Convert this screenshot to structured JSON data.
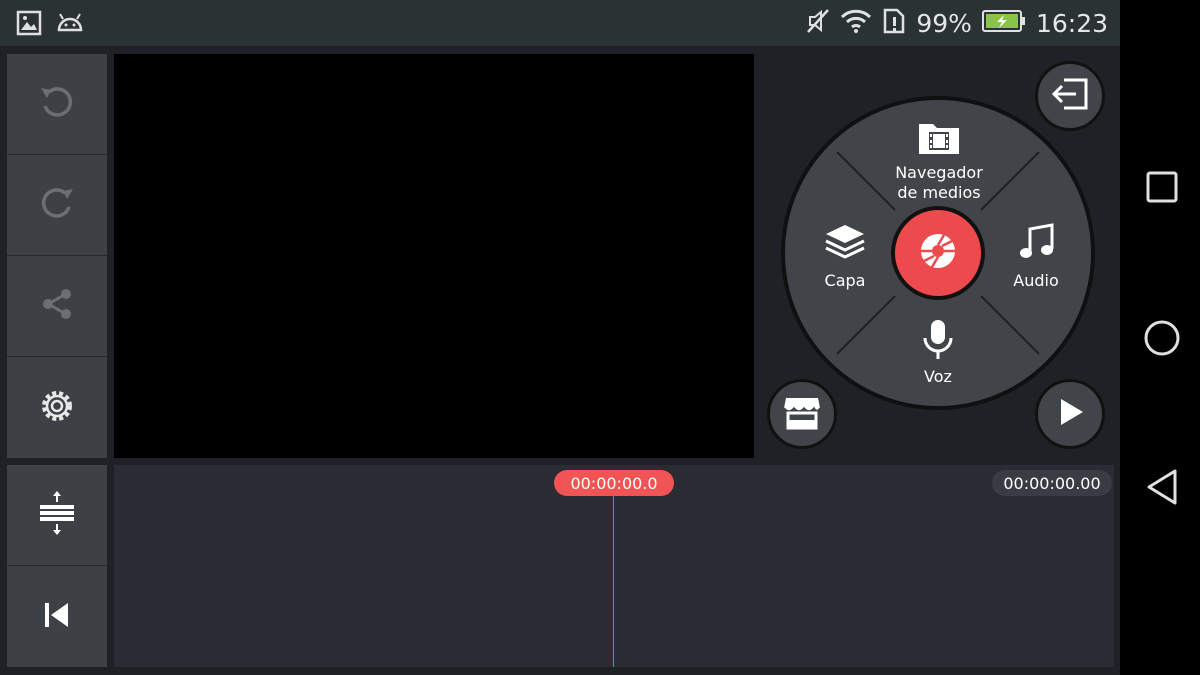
{
  "status_bar": {
    "battery_percent": "99%",
    "time": "16:23",
    "icons": [
      "gallery-icon",
      "android-icon",
      "mute-icon",
      "wifi-icon",
      "sim-alert-icon",
      "battery-charging-icon"
    ]
  },
  "left_toolbar": {
    "items": [
      "undo-icon",
      "redo-icon",
      "share-icon",
      "settings-icon"
    ]
  },
  "timeline_tools": {
    "items": [
      "expand-tracks-icon",
      "skip-to-start-icon"
    ]
  },
  "timeline": {
    "current_time": "00:00:00.0",
    "total_time": "00:00:00.00"
  },
  "media_wheel": {
    "top_label": "Navegador\nde medios",
    "left_label": "Capa",
    "right_label": "Audio",
    "bottom_label": "Voz",
    "center_icon": "camera-shutter-icon"
  },
  "colors": {
    "accent": "#ec4a4c",
    "panel": "#414449",
    "background": "#1f2126",
    "status_bar": "#2b3234"
  }
}
